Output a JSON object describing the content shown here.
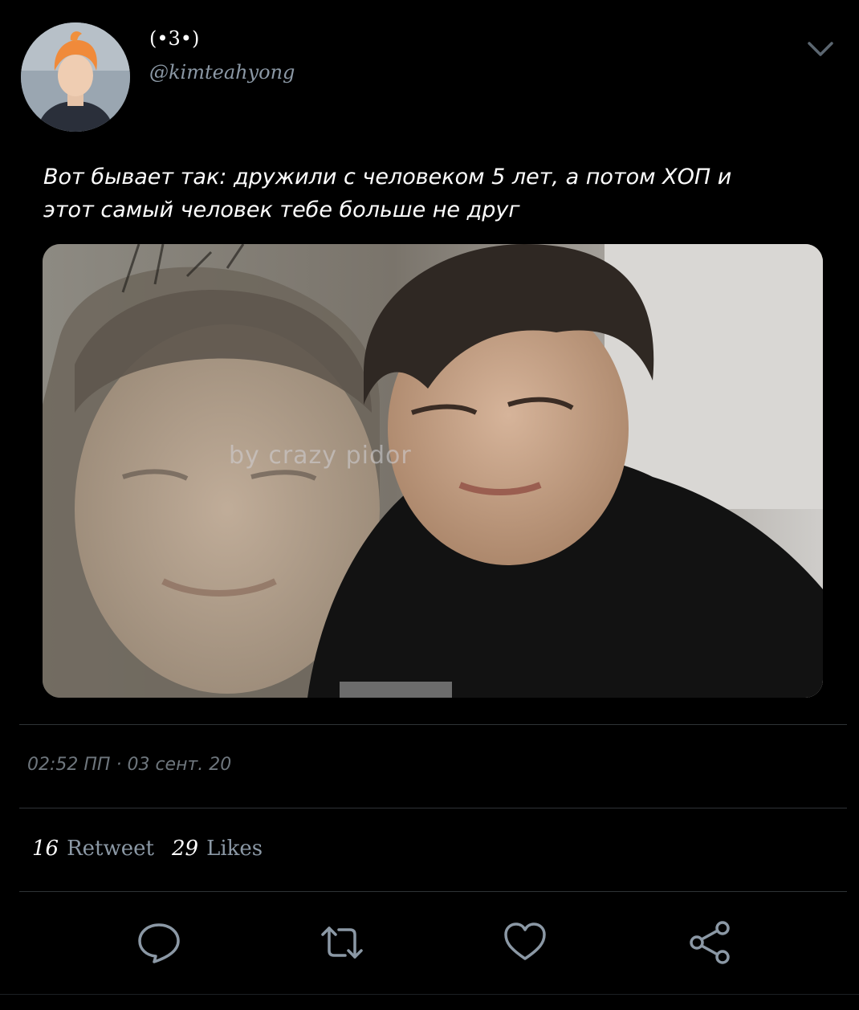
{
  "author": {
    "display_name": "(•3•)",
    "handle": "@kimteahyong"
  },
  "tweet": {
    "text_line1": "Вот бывает так: дружили с человеком  5 лет, а потом ХОП и",
    "text_line2": "этот самый человек тебе больше не друг",
    "watermark": "by crazy pidor",
    "timestamp": "02:52 ПП · 03 сент. 20"
  },
  "stats": {
    "retweets_count": "16",
    "retweets_label": "Retweet",
    "likes_count": "29",
    "likes_label": "Likes"
  },
  "icons": {
    "menu": "chevron-down-icon",
    "reply": "reply-icon",
    "retweet": "retweet-icon",
    "like": "heart-icon",
    "share": "share-icon"
  },
  "colors": {
    "background": "#000000",
    "text": "#ffffff",
    "secondary": "#8b98a5",
    "divider": "#2f3336",
    "icon": "#8b98a5"
  }
}
